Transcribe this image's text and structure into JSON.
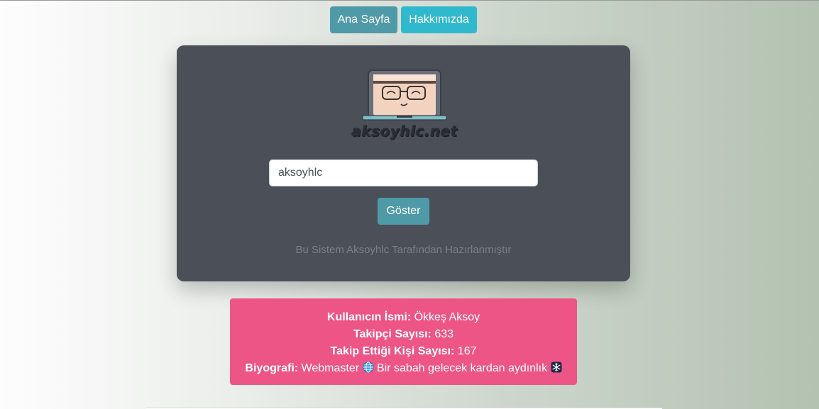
{
  "nav": {
    "home_label": "Ana Sayfa",
    "about_label": "Hakkımızda"
  },
  "card": {
    "logo_text": "aksoyhlc.net",
    "search": {
      "value": "aksoyhlc"
    },
    "show_label": "Göster",
    "footer_note": "Bu Sistem Aksoyhlc Tarafından Hazırlanmıştır"
  },
  "info": {
    "name_label": "Kullanıcın İsmi:",
    "name_value": "Ökkeş Aksoy",
    "followers_label": "Takipçi Sayısı:",
    "followers_value": "633",
    "following_label": "Takip Ettiği Kişi Sayısı:",
    "following_value": "167",
    "bio_label": "Biyografi:",
    "bio_text_1": "Webmaster",
    "bio_icon_1": "globe-icon",
    "bio_text_2": "Bir sabah gelecek kardan aydınlık",
    "bio_icon_2": "snowflake-icon"
  },
  "colors": {
    "primary_button": "#4f9aa8",
    "info_button": "#30b9cc",
    "card_bg": "#4b5058",
    "info_box": "#ec5585"
  }
}
